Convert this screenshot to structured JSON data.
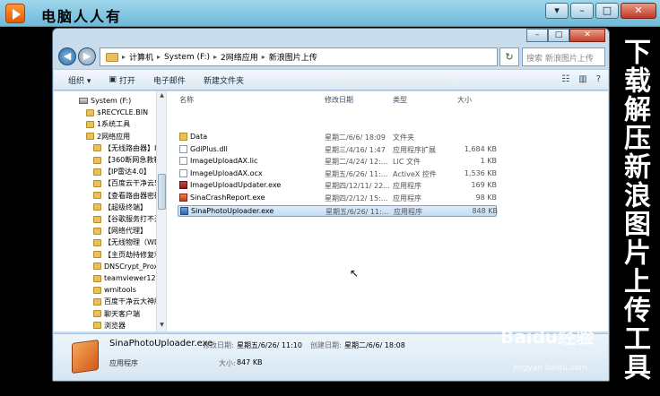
{
  "player": {
    "title": "电脑人人有",
    "controls": {
      "menu": "▾",
      "min": "–",
      "max": "□",
      "close": "✕"
    }
  },
  "window": {
    "controls": {
      "min": "–",
      "max": "□",
      "close": "✕"
    }
  },
  "address": {
    "crumbs": [
      "计算机",
      "System (F:)",
      "2网络应用",
      "新浪图片上传"
    ],
    "search_placeholder": "搜索 新浪图片上传"
  },
  "toolbar": {
    "organize": "组织 ▾",
    "open": "打开",
    "email": "电子邮件",
    "new_folder": "新建文件夹"
  },
  "nav": {
    "items": [
      {
        "label": "System (F:)",
        "type": "drive"
      },
      {
        "label": "$RECYCLE.BIN",
        "type": "folder"
      },
      {
        "label": "1系统工具",
        "type": "folder"
      },
      {
        "label": "2网络应用",
        "type": "folder"
      },
      {
        "label": "【无线路由器】IP带宽",
        "type": "folder"
      },
      {
        "label": "【360断网急救箱】",
        "type": "folder"
      },
      {
        "label": "【IP雷达4.0】",
        "type": "folder"
      },
      {
        "label": "【百度云干净云5.2",
        "type": "folder"
      },
      {
        "label": "【查看路由器密码",
        "type": "folder"
      },
      {
        "label": "【超级终端】",
        "type": "folder"
      },
      {
        "label": "【谷歌服务打不开",
        "type": "folder"
      },
      {
        "label": "【网络代理】",
        "type": "folder"
      },
      {
        "label": "【无线物理（WDS",
        "type": "folder"
      },
      {
        "label": "【主页劫持修复利",
        "type": "folder"
      },
      {
        "label": "DNSCrypt_Proxy_",
        "type": "folder"
      },
      {
        "label": "teamviewer12168",
        "type": "folder"
      },
      {
        "label": "wmitools",
        "type": "folder"
      },
      {
        "label": "百度干净云大神版",
        "type": "folder"
      },
      {
        "label": "聊天客户端",
        "type": "folder"
      },
      {
        "label": "浏览器",
        "type": "folder"
      }
    ]
  },
  "columns": {
    "name": "名称",
    "modified": "修改日期",
    "type": "类型",
    "size": "大小"
  },
  "files": [
    {
      "name": "Data",
      "modified": "星期二/6/6/ 18:09",
      "type": "文件夹",
      "size": "",
      "icon": "folder"
    },
    {
      "name": "GdiPlus.dll",
      "modified": "星期三/4/16/ 1:47",
      "type": "应用程序扩展",
      "size": "1,684 KB",
      "icon": "file"
    },
    {
      "name": "ImageUploadAX.lic",
      "modified": "星期二/4/24/ 12:...",
      "type": "LIC 文件",
      "size": "1 KB",
      "icon": "file"
    },
    {
      "name": "ImageUploadAX.ocx",
      "modified": "星期五/6/26/ 11:...",
      "type": "ActiveX 控件",
      "size": "1,536 KB",
      "icon": "file"
    },
    {
      "name": "ImageUploadUpdater.exe",
      "modified": "星期四/12/11/ 22...",
      "type": "应用程序",
      "size": "169 KB",
      "icon": "upd"
    },
    {
      "name": "SinaCrashReport.exe",
      "modified": "星期四/2/12/ 15:...",
      "type": "应用程序",
      "size": "98 KB",
      "icon": "crash"
    },
    {
      "name": "SinaPhotoUploader.exe",
      "modified": "星期五/6/26/ 11:...",
      "type": "应用程序",
      "size": "848 KB",
      "icon": "exe",
      "selected": true
    }
  ],
  "details": {
    "name": "SinaPhotoUploader.exe",
    "type": "应用程序",
    "modified_label": "修改日期:",
    "modified": "星期五/6/26/ 11:10",
    "created_label": "创建日期:",
    "created": "星期二/6/6/ 18:08",
    "size_label": "大小:",
    "size": "847 KB"
  },
  "caption": "下载解压新浪图片上传工具",
  "watermark": {
    "brand": "Baidu经验",
    "url": "jingyan.baidu.com"
  }
}
